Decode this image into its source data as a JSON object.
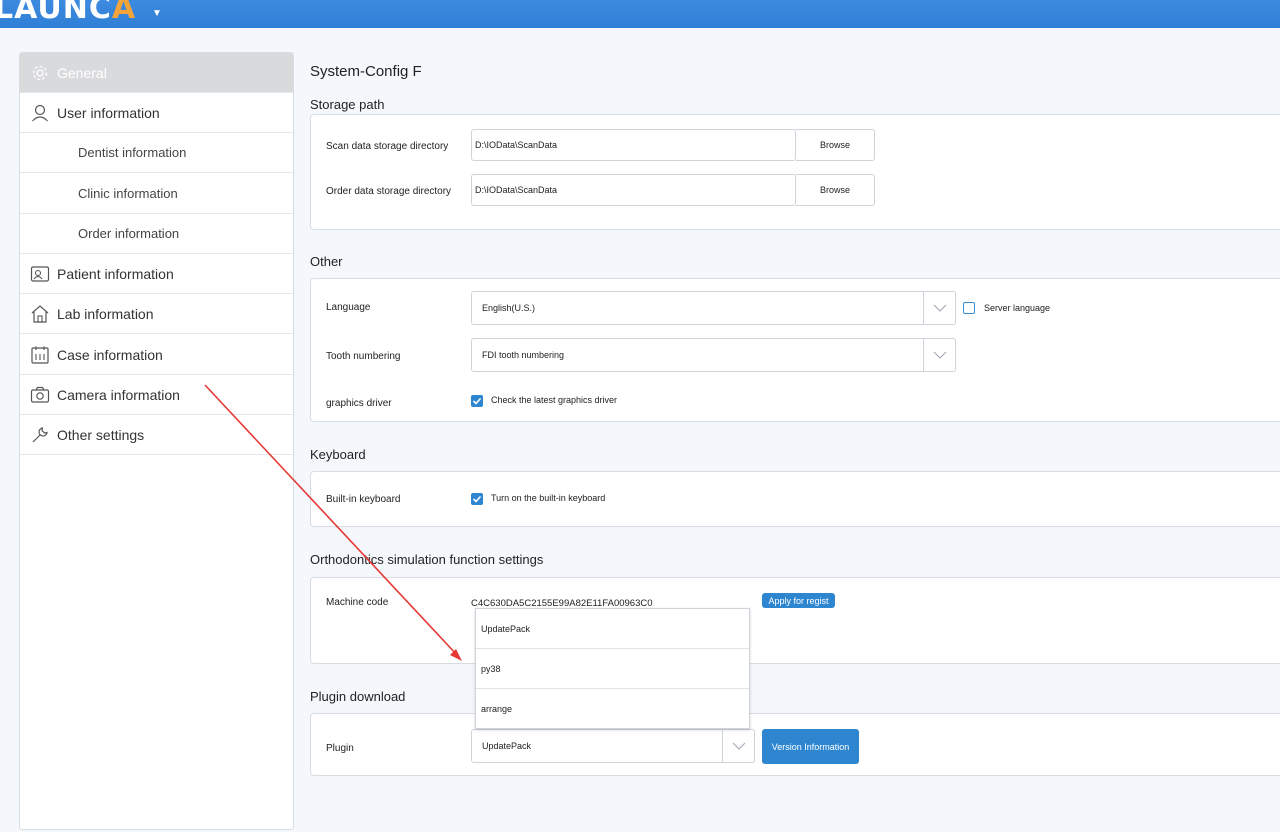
{
  "app": {
    "logo_main": "LAUNC",
    "logo_accent": "A",
    "logo_caret": "▼"
  },
  "sidebar": {
    "items": [
      {
        "label": "General",
        "icon": "gear-icon",
        "active": true
      },
      {
        "label": "User information",
        "icon": "user-icon"
      },
      {
        "label": "Dentist information",
        "sub": true
      },
      {
        "label": "Clinic information",
        "sub": true
      },
      {
        "label": "Order information",
        "sub": true
      },
      {
        "label": "Patient information",
        "icon": "patient-card-icon"
      },
      {
        "label": "Lab information",
        "icon": "home-icon"
      },
      {
        "label": "Case information",
        "icon": "calendar-icon"
      },
      {
        "label": "Camera information",
        "icon": "camera-icon"
      },
      {
        "label": "Other settings",
        "icon": "wrench-icon"
      }
    ]
  },
  "main": {
    "title": "System-Config F",
    "storage": {
      "title": "Storage path",
      "scan_label": "Scan data storage directory",
      "scan_value": "D:\\IOData\\ScanData",
      "order_label": "Order data storage directory",
      "order_value": "D:\\IOData\\ScanData",
      "browse_label": "Browse"
    },
    "other": {
      "title": "Other",
      "language_label": "Language",
      "language_value": "English(U.S.)",
      "server_language_label": "Server language",
      "server_language_checked": false,
      "tooth_label": "Tooth numbering",
      "tooth_value": "FDI tooth numbering",
      "graphics_label": "graphics driver",
      "graphics_check_label": "Check the latest graphics driver",
      "graphics_checked": true
    },
    "keyboard": {
      "title": "Keyboard",
      "builtin_label": "Built-in keyboard",
      "builtin_check_label": "Turn on the built-in keyboard",
      "builtin_checked": true
    },
    "ortho": {
      "title": "Orthodontics simulation function settings",
      "machine_label": "Machine code",
      "machine_value": "C4C630DA5C2155E99A82E11FA00963C0",
      "apply_label": "Apply for regist"
    },
    "plugin": {
      "title": "Plugin download",
      "plugin_label": "Plugin",
      "plugin_value": "UpdatePack",
      "version_label": "Version Information",
      "options": [
        "UpdatePack",
        "py38",
        "arrange"
      ]
    }
  },
  "colors": {
    "topbar": "#2f7fd6",
    "accent": "#2e86d1",
    "annotation_arrow": "#e53935",
    "logo_accent": "#f2a33a"
  }
}
